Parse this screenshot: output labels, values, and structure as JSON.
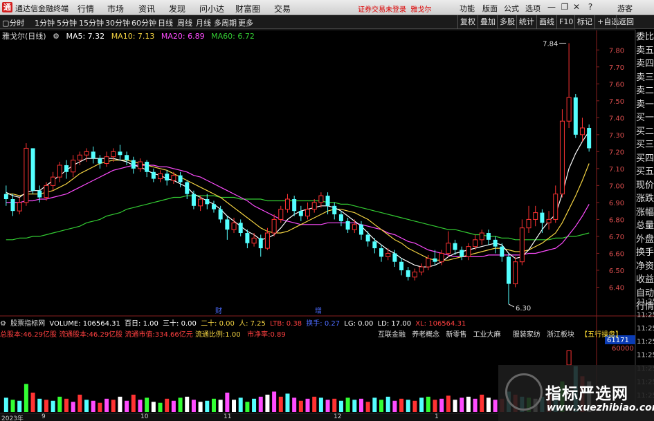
{
  "titlebar": {
    "app_name": "通达信金融终端",
    "menus": [
      "行情",
      "市场",
      "资讯",
      "发现",
      "问小达",
      "财富圈",
      "交易"
    ],
    "warning": "证券交易未登录",
    "stock": "雅戈尔",
    "right_menus": [
      "功能",
      "版面",
      "公式",
      "选项"
    ],
    "guest": "游客"
  },
  "toolbar": {
    "periods": [
      "分时",
      "1分钟",
      "5分钟",
      "15分钟",
      "30分钟",
      "60分钟",
      "日线",
      "周线",
      "月线",
      "多周期",
      "更多"
    ],
    "right_tools": [
      "复权",
      "叠加",
      "多股",
      "统计",
      "画线",
      "F10",
      "标记",
      "+自选",
      "返回"
    ]
  },
  "chart_header": {
    "stock_label": "雅戈尔(日线)",
    "ma5": "MA5: 7.32",
    "ma10": "MA10: 7.13",
    "ma20": "MA20: 6.89",
    "ma60": "MA60: 6.72"
  },
  "price_axis": [
    "7.80",
    "7.70",
    "7.60",
    "7.50",
    "7.40",
    "7.30",
    "7.20",
    "7.10",
    "7.00",
    "6.90",
    "6.80",
    "6.70",
    "6.60",
    "6.50",
    "6.40"
  ],
  "annotations": {
    "high": "7.84",
    "low": "6.30",
    "marker_cai": "财",
    "marker_zeng": "增"
  },
  "right_column": [
    "委比",
    "卖五",
    "卖四",
    "卖三",
    "卖二",
    "卖一",
    "买一",
    "买二",
    "买三",
    "买四",
    "买五",
    "现价",
    "涨跌",
    "涨幅",
    "总量",
    "外盘",
    "换手",
    "净资",
    "收益",
    "自动",
    "行情"
  ],
  "time_axis": [
    "11:25",
    "11:25",
    "11:25",
    "11:25",
    "11:25",
    "11:25",
    "11:25",
    "11:25"
  ],
  "volume_header": {
    "indicator": "股票指标网",
    "volume": "VOLUME: 106564.31",
    "bai": "百日: 1.00",
    "sanshi": "三十: 0.00",
    "ershi": "二十: 0.00",
    "ren": "人: 7.25",
    "ltb": "LTB: 0.38",
    "yi": "换手: 0.27",
    "lg": "LG: 0.00",
    "ld": "LD: 17.00",
    "xl": "XL: 106564.31"
  },
  "volume_header2": {
    "total": "总股本:46.29亿股",
    "float": "流通股本:46.29亿股",
    "mcap": "流通市值:334.66亿元",
    "ratio": "流通比例:1.00",
    "pb": "市净率:0.89"
  },
  "concepts": [
    "互联金融",
    "养老概念",
    "新零售",
    "工业大麻",
    "服装家纺",
    "浙江板块"
  ],
  "wuxing": "【五行操盘】",
  "volume_axis": [
    "61171",
    "60000"
  ],
  "scroll_labels": [
    "2023年",
    "9",
    "10",
    "11",
    "12",
    "1"
  ],
  "watermark": {
    "cn": "指标严选网",
    "url": "www.xuezhibiao.com"
  },
  "colors": {
    "up": "#ff3333",
    "down": "#54ffff",
    "ma5": "#ffffff",
    "ma10": "#f5d442",
    "ma20": "#ff4cff",
    "ma60": "#33cc33"
  },
  "chart_data": {
    "type": "candlestick",
    "ylim": [
      6.3,
      7.85
    ],
    "candles": [
      [
        6.95,
        6.92,
        7.0,
        6.88
      ],
      [
        6.92,
        6.85,
        6.95,
        6.82
      ],
      [
        6.85,
        6.9,
        6.93,
        6.83
      ],
      [
        6.9,
        7.22,
        7.25,
        6.88
      ],
      [
        7.22,
        6.97,
        7.22,
        6.95
      ],
      [
        6.97,
        6.93,
        7.0,
        6.9
      ],
      [
        6.93,
        7.0,
        7.02,
        6.91
      ],
      [
        7.0,
        7.05,
        7.08,
        6.97
      ],
      [
        7.05,
        7.12,
        7.14,
        7.02
      ],
      [
        7.12,
        7.08,
        7.15,
        7.04
      ],
      [
        7.08,
        7.15,
        7.18,
        7.05
      ],
      [
        7.15,
        7.18,
        7.2,
        7.12
      ],
      [
        7.18,
        7.2,
        7.22,
        7.14
      ],
      [
        7.2,
        7.16,
        7.23,
        7.13
      ],
      [
        7.16,
        7.13,
        7.18,
        7.1
      ],
      [
        7.13,
        7.17,
        7.2,
        7.11
      ],
      [
        7.17,
        7.2,
        7.22,
        7.14
      ],
      [
        7.2,
        7.18,
        7.24,
        7.15
      ],
      [
        7.18,
        7.15,
        7.2,
        7.12
      ],
      [
        7.15,
        7.1,
        7.17,
        7.07
      ],
      [
        7.1,
        7.14,
        7.16,
        7.08
      ],
      [
        7.14,
        7.08,
        7.15,
        7.05
      ],
      [
        7.08,
        7.04,
        7.1,
        7.02
      ],
      [
        7.04,
        7.07,
        7.09,
        7.02
      ],
      [
        7.07,
        7.03,
        7.09,
        7.0
      ],
      [
        7.03,
        7.06,
        7.08,
        7.01
      ],
      [
        7.06,
        7.02,
        7.08,
        6.99
      ],
      [
        7.02,
        6.95,
        7.03,
        6.92
      ],
      [
        6.95,
        6.88,
        6.97,
        6.86
      ],
      [
        6.88,
        6.92,
        6.94,
        6.85
      ],
      [
        6.92,
        6.89,
        6.95,
        6.86
      ],
      [
        6.89,
        6.86,
        6.91,
        6.84
      ],
      [
        6.86,
        6.8,
        6.88,
        6.78
      ],
      [
        6.8,
        6.74,
        6.82,
        6.68
      ],
      [
        6.74,
        6.78,
        6.81,
        6.72
      ],
      [
        6.78,
        6.72,
        6.8,
        6.7
      ],
      [
        6.72,
        6.66,
        6.74,
        6.63
      ],
      [
        6.66,
        6.69,
        6.72,
        6.64
      ],
      [
        6.69,
        6.63,
        6.71,
        6.58
      ],
      [
        6.63,
        6.72,
        6.75,
        6.62
      ],
      [
        6.72,
        6.8,
        6.83,
        6.7
      ],
      [
        6.8,
        6.86,
        6.88,
        6.78
      ],
      [
        6.86,
        6.92,
        6.95,
        6.84
      ],
      [
        6.92,
        6.85,
        6.94,
        6.82
      ],
      [
        6.85,
        6.82,
        6.88,
        6.79
      ],
      [
        6.82,
        6.86,
        6.9,
        6.8
      ],
      [
        6.86,
        6.9,
        6.92,
        6.84
      ],
      [
        6.9,
        6.94,
        6.96,
        6.87
      ],
      [
        6.94,
        6.88,
        6.96,
        6.83
      ],
      [
        6.88,
        6.83,
        6.9,
        6.8
      ],
      [
        6.83,
        6.79,
        6.85,
        6.76
      ],
      [
        6.79,
        6.74,
        6.81,
        6.72
      ],
      [
        6.74,
        6.77,
        6.8,
        6.72
      ],
      [
        6.77,
        6.71,
        6.79,
        6.68
      ],
      [
        6.71,
        6.67,
        6.73,
        6.64
      ],
      [
        6.67,
        6.63,
        6.69,
        6.6
      ],
      [
        6.63,
        6.58,
        6.65,
        6.55
      ],
      [
        6.58,
        6.6,
        6.63,
        6.56
      ],
      [
        6.6,
        6.55,
        6.62,
        6.52
      ],
      [
        6.55,
        6.5,
        6.57,
        6.47
      ],
      [
        6.5,
        6.46,
        6.52,
        6.44
      ],
      [
        6.46,
        6.49,
        6.51,
        6.44
      ],
      [
        6.49,
        6.52,
        6.54,
        6.47
      ],
      [
        6.52,
        6.57,
        6.59,
        6.5
      ],
      [
        6.57,
        6.55,
        6.62,
        6.53
      ],
      [
        6.55,
        6.6,
        6.62,
        6.53
      ],
      [
        6.6,
        6.66,
        6.73,
        6.58
      ],
      [
        6.66,
        6.62,
        6.68,
        6.59
      ],
      [
        6.62,
        6.58,
        6.64,
        6.56
      ],
      [
        6.58,
        6.64,
        6.66,
        6.56
      ],
      [
        6.64,
        6.68,
        6.71,
        6.62
      ],
      [
        6.68,
        6.72,
        6.74,
        6.65
      ],
      [
        6.72,
        6.68,
        6.74,
        6.65
      ],
      [
        6.68,
        6.64,
        6.7,
        6.6
      ],
      [
        6.64,
        6.58,
        6.66,
        6.55
      ],
      [
        6.58,
        6.42,
        6.6,
        6.3
      ],
      [
        6.42,
        6.55,
        6.58,
        6.4
      ],
      [
        6.55,
        6.75,
        6.8,
        6.53
      ],
      [
        6.75,
        6.8,
        6.88,
        6.72
      ],
      [
        6.8,
        6.84,
        6.88,
        6.76
      ],
      [
        6.84,
        6.78,
        6.86,
        6.72
      ],
      [
        6.78,
        6.8,
        6.85,
        6.74
      ],
      [
        6.8,
        6.95,
        7.0,
        6.78
      ],
      [
        6.95,
        7.38,
        7.45,
        6.93
      ],
      [
        7.38,
        7.52,
        7.84,
        7.34
      ],
      [
        7.52,
        7.3,
        7.54,
        7.28
      ],
      [
        7.3,
        7.34,
        7.4,
        7.26
      ],
      [
        7.34,
        7.22,
        7.36,
        7.2
      ]
    ],
    "ma5": [
      6.96,
      6.94,
      6.93,
      6.96,
      6.97,
      6.97,
      7.0,
      7.03,
      7.06,
      7.09,
      7.12,
      7.14,
      7.16,
      7.16,
      7.16,
      7.16,
      7.16,
      7.15,
      7.14,
      7.12,
      7.11,
      7.09,
      7.07,
      7.06,
      7.04,
      7.03,
      7.01,
      6.99,
      6.95,
      6.93,
      6.91,
      6.89,
      6.86,
      6.82,
      6.79,
      6.76,
      6.73,
      6.71,
      6.68,
      6.69,
      6.71,
      6.75,
      6.8,
      6.83,
      6.85,
      6.86,
      6.87,
      6.88,
      6.88,
      6.87,
      6.85,
      6.82,
      6.79,
      6.76,
      6.72,
      6.68,
      6.65,
      6.62,
      6.6,
      6.57,
      6.55,
      6.53,
      6.52,
      6.52,
      6.53,
      6.55,
      6.58,
      6.6,
      6.61,
      6.62,
      6.63,
      6.64,
      6.65,
      6.66,
      6.65,
      6.6,
      6.57,
      6.58,
      6.62,
      6.68,
      6.74,
      6.79,
      6.83,
      6.95,
      7.1,
      7.19,
      7.26,
      7.32
    ],
    "ma10": [
      6.95,
      6.95,
      6.94,
      6.95,
      6.95,
      6.95,
      6.96,
      6.97,
      6.99,
      7.01,
      7.04,
      7.07,
      7.09,
      7.11,
      7.13,
      7.14,
      7.15,
      7.15,
      7.15,
      7.14,
      7.13,
      7.12,
      7.11,
      7.1,
      7.09,
      7.07,
      7.05,
      7.03,
      7.01,
      6.99,
      6.97,
      6.95,
      6.93,
      6.9,
      6.87,
      6.84,
      6.81,
      6.78,
      6.75,
      6.73,
      6.72,
      6.72,
      6.73,
      6.75,
      6.77,
      6.79,
      6.81,
      6.83,
      6.85,
      6.86,
      6.86,
      6.85,
      6.84,
      6.82,
      6.8,
      6.77,
      6.74,
      6.71,
      6.68,
      6.66,
      6.63,
      6.61,
      6.59,
      6.57,
      6.56,
      6.56,
      6.56,
      6.57,
      6.58,
      6.59,
      6.6,
      6.61,
      6.62,
      6.63,
      6.63,
      6.62,
      6.61,
      6.61,
      6.62,
      6.64,
      6.66,
      6.69,
      6.72,
      6.78,
      6.86,
      6.94,
      7.03,
      7.13
    ],
    "ma20": [
      6.9,
      6.9,
      6.9,
      6.91,
      6.91,
      6.92,
      6.92,
      6.93,
      6.94,
      6.95,
      6.97,
      6.99,
      7.01,
      7.03,
      7.05,
      7.07,
      7.09,
      7.1,
      7.11,
      7.12,
      7.12,
      7.12,
      7.12,
      7.11,
      7.11,
      7.1,
      7.09,
      7.08,
      7.06,
      7.05,
      7.03,
      7.01,
      6.99,
      6.97,
      6.95,
      6.93,
      6.91,
      6.88,
      6.86,
      6.84,
      6.82,
      6.8,
      6.79,
      6.78,
      6.77,
      6.77,
      6.77,
      6.77,
      6.78,
      6.78,
      6.78,
      6.78,
      6.78,
      6.77,
      6.76,
      6.75,
      6.74,
      6.72,
      6.71,
      6.69,
      6.67,
      6.66,
      6.64,
      6.62,
      6.61,
      6.6,
      6.59,
      6.58,
      6.58,
      6.58,
      6.58,
      6.58,
      6.59,
      6.59,
      6.59,
      6.59,
      6.59,
      6.59,
      6.6,
      6.6,
      6.61,
      6.62,
      6.63,
      6.66,
      6.71,
      6.76,
      6.82,
      6.89
    ],
    "ma60": [
      6.68,
      6.68,
      6.69,
      6.69,
      6.7,
      6.7,
      6.71,
      6.72,
      6.73,
      6.74,
      6.75,
      6.76,
      6.78,
      6.79,
      6.8,
      6.82,
      6.83,
      6.84,
      6.86,
      6.87,
      6.88,
      6.89,
      6.9,
      6.91,
      6.92,
      6.93,
      6.93,
      6.94,
      6.94,
      6.94,
      6.94,
      6.94,
      6.93,
      6.93,
      6.93,
      6.92,
      6.92,
      6.92,
      6.92,
      6.91,
      6.91,
      6.91,
      6.91,
      6.91,
      6.91,
      6.91,
      6.91,
      6.91,
      6.9,
      6.9,
      6.89,
      6.89,
      6.88,
      6.87,
      6.86,
      6.85,
      6.84,
      6.83,
      6.82,
      6.81,
      6.8,
      6.79,
      6.78,
      6.77,
      6.76,
      6.75,
      6.74,
      6.74,
      6.73,
      6.72,
      6.71,
      6.71,
      6.7,
      6.7,
      6.69,
      6.69,
      6.68,
      6.68,
      6.68,
      6.68,
      6.68,
      6.68,
      6.69,
      6.69,
      6.7,
      6.7,
      6.71,
      6.72
    ],
    "volumes": [
      28,
      24,
      22,
      55,
      38,
      26,
      24,
      22,
      30,
      26,
      20,
      34,
      24,
      22,
      18,
      26,
      24,
      30,
      22,
      34,
      24,
      28,
      20,
      18,
      26,
      22,
      28,
      30,
      24,
      20,
      22,
      26,
      24,
      38,
      24,
      28,
      20,
      26,
      30,
      34,
      40,
      30,
      36,
      28,
      22,
      26,
      30,
      28,
      24,
      26,
      22,
      28,
      24,
      26,
      20,
      28,
      24,
      30,
      22,
      26,
      24,
      22,
      28,
      30,
      24,
      26,
      32,
      24,
      28,
      30,
      26,
      34,
      28,
      24,
      26,
      40,
      34,
      30,
      28,
      26,
      30,
      32,
      28,
      60,
      120,
      90,
      70,
      60
    ]
  }
}
